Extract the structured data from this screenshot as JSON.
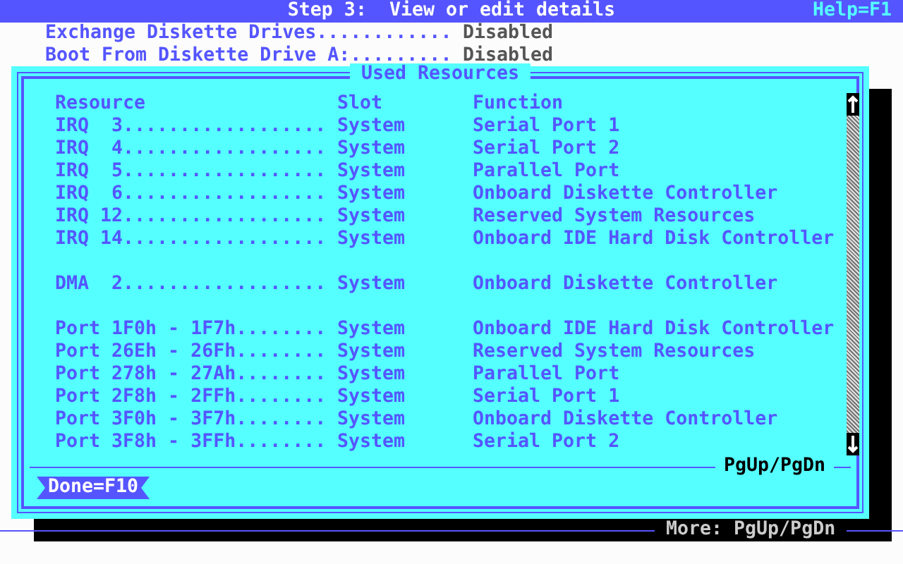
{
  "title_bar": {
    "title": "Step 3:  View or edit details",
    "help": "Help=F1"
  },
  "settings": [
    {
      "label": "Exchange Diskette Drives............",
      "value": "Disabled"
    },
    {
      "label": "Boot From Diskette Drive A:.........",
      "value": "Disabled"
    }
  ],
  "dialog": {
    "title": "Used Resources",
    "columns": [
      "Resource",
      "Slot",
      "Function"
    ],
    "groups": [
      {
        "rows": [
          [
            "IRQ  3..................",
            "System",
            "Serial Port 1"
          ],
          [
            "IRQ  4..................",
            "System",
            "Serial Port 2"
          ],
          [
            "IRQ  5..................",
            "System",
            "Parallel Port"
          ],
          [
            "IRQ  6..................",
            "System",
            "Onboard Diskette Controller"
          ],
          [
            "IRQ 12..................",
            "System",
            "Reserved System Resources"
          ],
          [
            "IRQ 14..................",
            "System",
            "Onboard IDE Hard Disk Controller"
          ]
        ]
      },
      {
        "rows": [
          [
            "DMA  2..................",
            "System",
            "Onboard Diskette Controller"
          ]
        ]
      },
      {
        "rows": [
          [
            "Port 1F0h - 1F7h........",
            "System",
            "Onboard IDE Hard Disk Controller"
          ],
          [
            "Port 26Eh - 26Fh........",
            "System",
            "Reserved System Resources"
          ],
          [
            "Port 278h - 27Ah........",
            "System",
            "Parallel Port"
          ],
          [
            "Port 2F8h - 2FFh........",
            "System",
            "Serial Port 1"
          ],
          [
            "Port 3F0h - 3F7h........",
            "System",
            "Onboard Diskette Controller"
          ],
          [
            "Port 3F8h - 3FFh........",
            "System",
            "Serial Port 2"
          ]
        ]
      }
    ],
    "paging_hint": "PgUp/PgDn",
    "done_button": "Done=F10"
  },
  "footer": {
    "more": "More: PgUp/PgDn"
  }
}
